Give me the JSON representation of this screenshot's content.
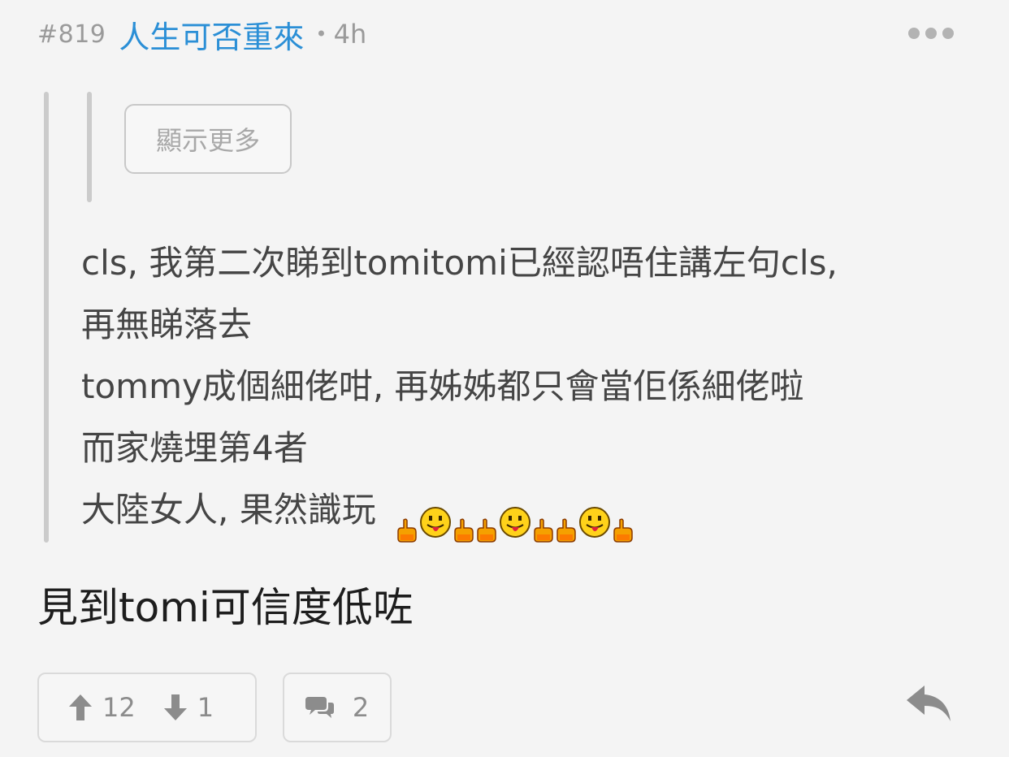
{
  "post": {
    "number": "#819",
    "username": "人生可否重來",
    "separator": "•",
    "time": "4h"
  },
  "quote": {
    "show_more_label": "顯示更多",
    "lines": [
      "cls, 我第二次睇到tomitomi已經認唔住講左句cls,",
      "再無睇落去",
      "tommy成個細佬咁, 再姊姊都只會當佢係細佬啦",
      "而家燒埋第4者",
      "大陸女人, 果然識玩"
    ],
    "emoji_sequence": [
      "fire-hand-icon",
      "tongue-smiley-icon",
      "fire-hand-icon",
      "fire-hand-icon",
      "tongue-smiley-icon",
      "fire-hand-icon",
      "fire-hand-icon",
      "tongue-smiley-icon",
      "fire-hand-icon"
    ]
  },
  "reply": {
    "text": "見到tomi可信度低咗"
  },
  "footer": {
    "upvotes": "12",
    "downvotes": "1",
    "comments": "2"
  },
  "icons": {
    "more": "ellipsis-icon",
    "upvote": "arrow-up-icon",
    "downvote": "arrow-down-icon",
    "comment": "speech-bubbles-icon",
    "reply": "reply-arrow-icon"
  },
  "colors": {
    "background": "#f4f4f4",
    "username": "#2b8fd6",
    "muted": "#9a9a9a",
    "quote_text": "#454545",
    "reply_text": "#1d1d1d"
  }
}
